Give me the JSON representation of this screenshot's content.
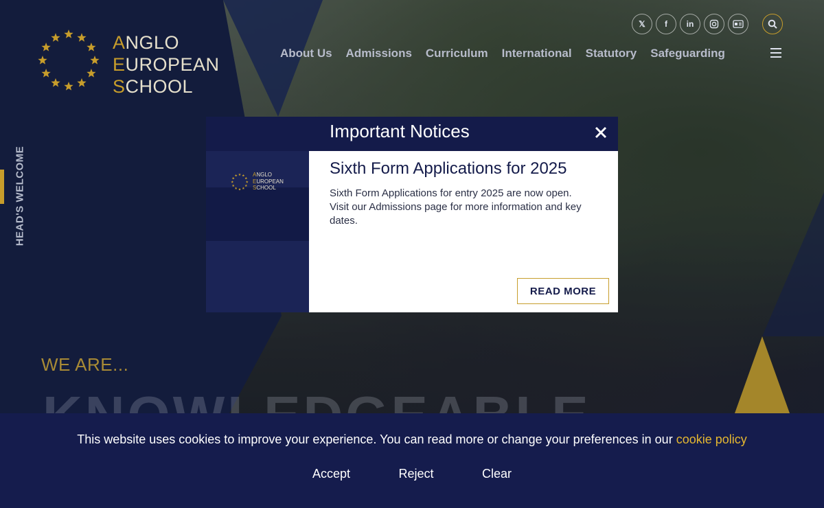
{
  "site": {
    "logo_initials": [
      "A",
      "E",
      "S"
    ],
    "logo_rests": [
      "NGLO",
      "UROPEAN",
      "CHOOL"
    ]
  },
  "social": {
    "icons": [
      "x-icon",
      "facebook-icon",
      "linkedin-icon",
      "instagram-icon",
      "id-card-icon",
      "search-icon"
    ]
  },
  "nav": {
    "items": [
      "About Us",
      "Admissions",
      "Curriculum",
      "International",
      "Statutory",
      "Safeguarding"
    ]
  },
  "side_tab": {
    "label": "HEAD'S WELCOME"
  },
  "hero": {
    "we_are": "WE ARE...",
    "word": "KNOWLEDGEABLE"
  },
  "modal": {
    "title": "Important Notices",
    "notice_title": "Sixth Form Applications for 2025",
    "notice_text": "Sixth Form Applications for entry 2025 are now open. Visit our Admissions page for more information and key dates.",
    "read_more": "READ MORE"
  },
  "cookie": {
    "text": "This website uses cookies to improve your experience. You can read more or change your preferences in our ",
    "link": "cookie policy",
    "accept": "Accept",
    "reject": "Reject",
    "clear": "Clear"
  },
  "colors": {
    "navy": "#141b4a",
    "gold": "#c79d2b",
    "link": "#e6b830"
  }
}
